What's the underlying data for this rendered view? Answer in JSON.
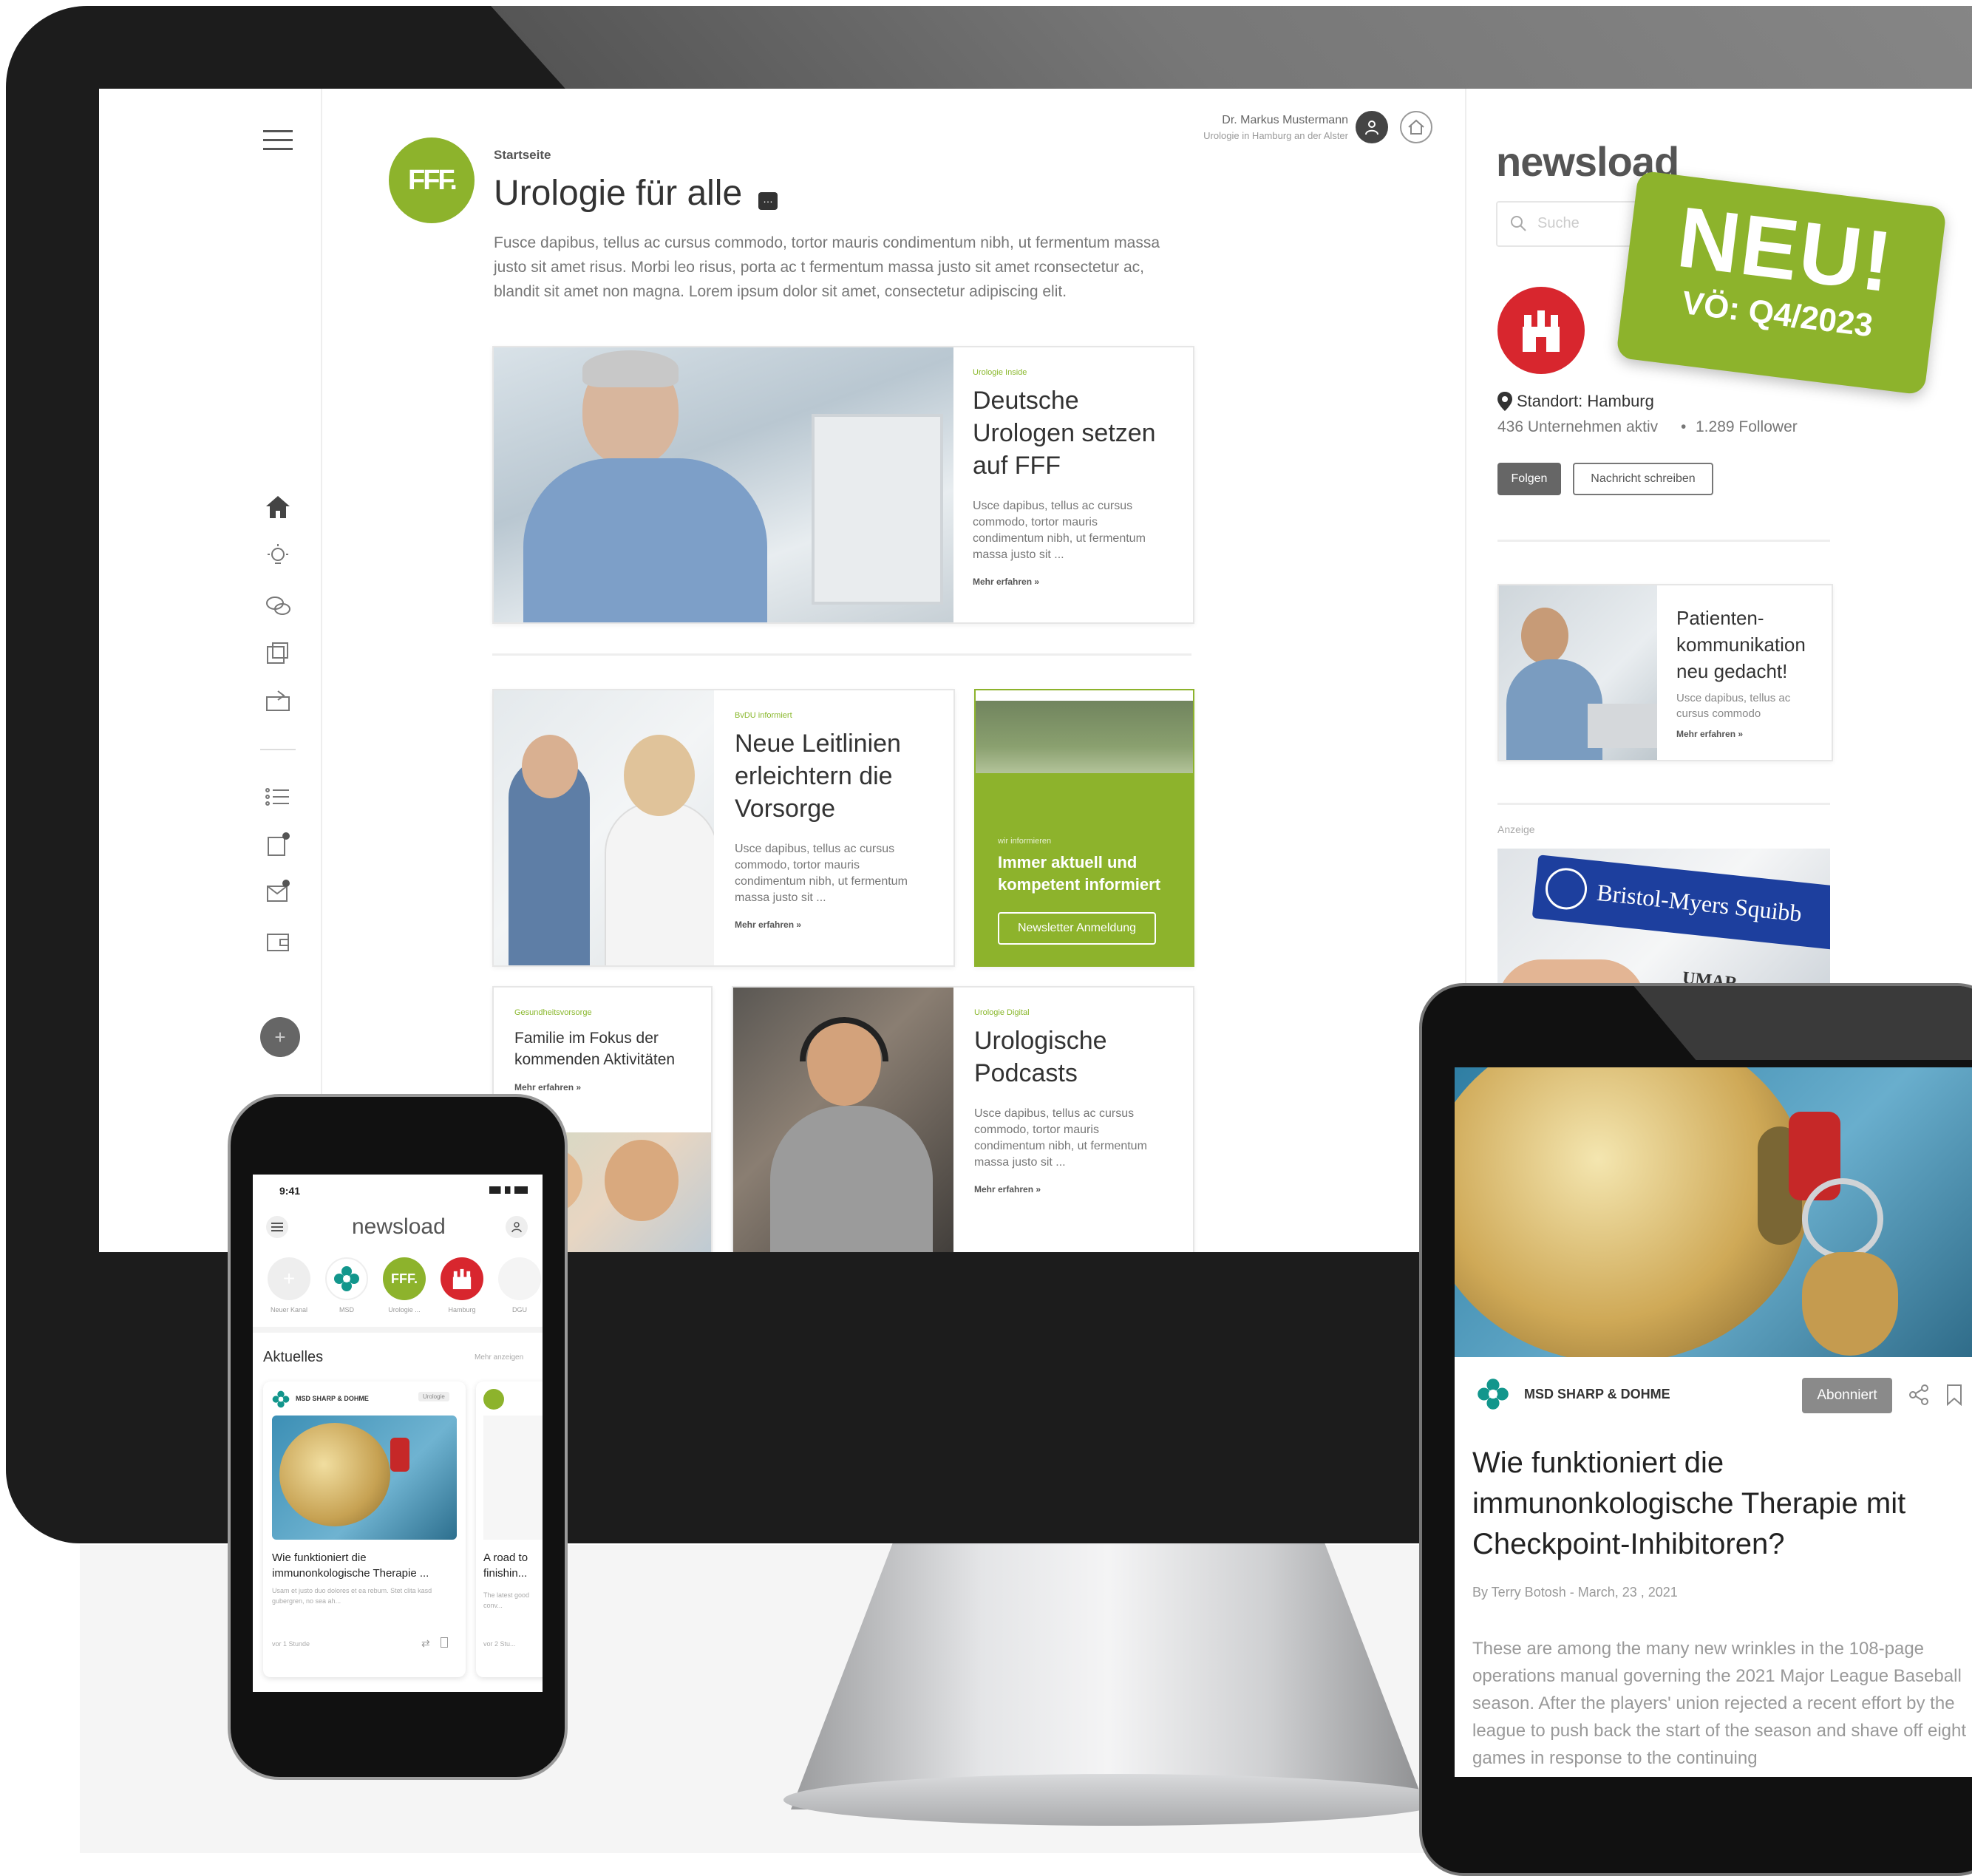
{
  "header": {
    "user_name": "Dr. Markus Mustermann",
    "user_sub": "Urologie in Hamburg an der Alster"
  },
  "page": {
    "breadcrumb": "Startseite",
    "title": "Urologie für alle",
    "logo_text": "FFF.",
    "intro": "Fusce dapibus, tellus ac cursus commodo, tortor mauris condimentum nibh, ut fermentum massa justo sit amet risus. Morbi leo risus, porta ac t fermentum massa justo sit amet rconsectetur ac, blandit sit amet non magna. Lorem ipsum dolor sit amet, consectetur adipiscing elit."
  },
  "featured": {
    "kicker": "Urologie Inside",
    "title": "Deutsche Urologen setzen auf FFF",
    "body": "Usce dapibus, tellus ac cursus commodo, tortor mauris condimentum nibh, ut fermentum massa justo sit ...",
    "more": "Mehr erfahren »"
  },
  "card2": {
    "kicker": "BvDU informiert",
    "title": "Neue Leitlinien erleichtern die Vorsorge",
    "body": "Usce dapibus, tellus ac cursus commodo, tortor mauris condimentum nibh, ut fermentum massa justo sit ...",
    "more": "Mehr erfahren »"
  },
  "newsletter": {
    "kicker": "wir informieren",
    "title": "Immer aktuell und kompetent informiert",
    "button": "Newsletter Anmeldung"
  },
  "card3": {
    "kicker": "Gesundheitsvorsorge",
    "title": "Familie im Fokus der kommenden Aktivitäten",
    "more": "Mehr erfahren »"
  },
  "card4": {
    "kicker": "Urologie Digital",
    "title": "Urologische Podcasts",
    "body": "Usce dapibus, tellus ac cursus commodo, tortor mauris condimentum nibh, ut fermentum massa justo sit ...",
    "more": "Mehr erfahren »"
  },
  "right": {
    "brand": "newsload",
    "search_placeholder": "Suche",
    "location_label": "Standort: Hamburg",
    "stats_companies": "436 Unternehmen aktiv",
    "stats_dot": "•",
    "stats_followers": "1.289 Follower",
    "follow_button": "Folgen",
    "message_button": "Nachricht schreiben",
    "promo_title": "Patienten-kommunikation neu gedacht!",
    "promo_body": "Usce dapibus, tellus ac cursus commodo",
    "promo_more": "Mehr erfahren »",
    "ad_label": "Anzeige",
    "ad_brand": "Bristol-Myers Squibb",
    "ad_sub": "UMAR"
  },
  "badge": {
    "title": "NEU!",
    "subtitle": "VÖ: Q4/2023",
    "color": "#8db32c"
  },
  "phone": {
    "time": "9:41",
    "brand": "newsload",
    "channels": [
      {
        "label": "Neuer Kanal"
      },
      {
        "label": "MSD"
      },
      {
        "label": "Urologie ..."
      },
      {
        "label": "Hamburg"
      },
      {
        "label": "DGU"
      }
    ],
    "section_title": "Aktuelles",
    "section_more": "Mehr anzeigen",
    "card_publisher": "MSD SHARP & DOHME",
    "card_tag": "Urologie",
    "card_title": "Wie funktioniert die immunonkologische Therapie ...",
    "card_body": "Usam et justo duo dolores et ea rebum. Stet clita kasd gubergren, no sea ah...",
    "card_time": "vor 1 Stunde",
    "card2_title": "A road to finishin...",
    "card2_body": "The latest good conv...",
    "card2_time": "vor 2 Stu..."
  },
  "tablet": {
    "publisher": "MSD SHARP & DOHME",
    "subscribed": "Abonniert",
    "title": "Wie funktioniert die immunonkologische Therapie mit Checkpoint-Inhibitoren?",
    "byline": "By Terry Botosh - March, 23 , 2021",
    "body": "These are among the many new wrinkles in the 108-page operations manual governing the 2021 Major League Baseball season. After the players' union rejected a recent effort by the league to push back the start of the season and shave off eight games in response to the continuing"
  },
  "colors": {
    "accent": "#8db32c",
    "hamburg_red": "#d8262e",
    "msd_teal": "#12968c",
    "bms_blue": "#1d3f9e"
  },
  "icons": [
    "menu-icon",
    "home-icon",
    "bulb-icon",
    "chat-icon",
    "gallery-icon",
    "share-icon",
    "list-icon",
    "notes-icon",
    "mail-icon",
    "wallet-icon",
    "plus-icon",
    "user-icon",
    "home-outline-icon",
    "search-icon",
    "location-icon",
    "bookmark-icon"
  ]
}
